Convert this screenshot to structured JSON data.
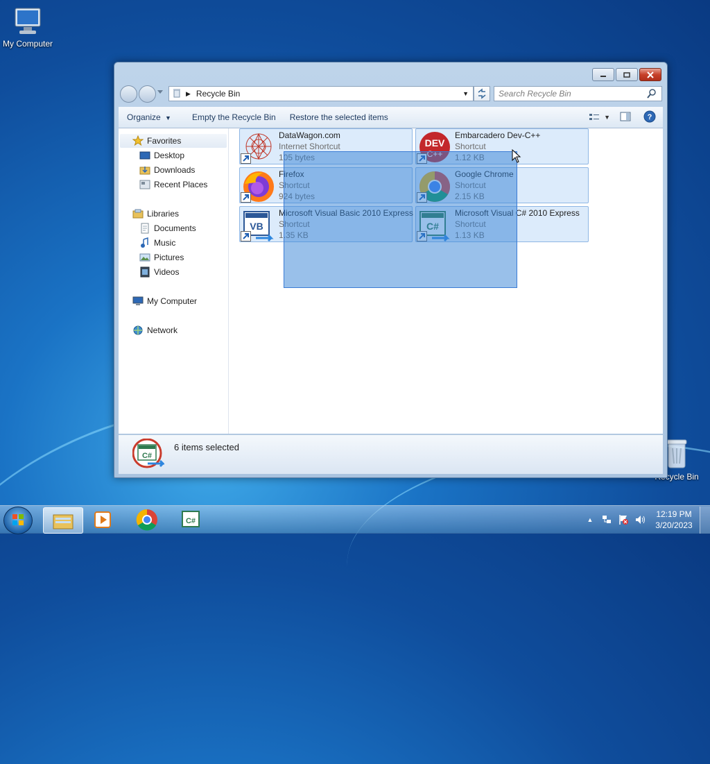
{
  "desktop": {
    "icons": [
      {
        "label": "My Computer",
        "icon": "computer-icon"
      },
      {
        "label": "Recycle Bin",
        "icon": "recycle-bin-icon"
      }
    ]
  },
  "window": {
    "address": {
      "location": "Recycle Bin"
    },
    "search": {
      "placeholder": "Search Recycle Bin"
    },
    "toolbar": {
      "organize": "Organize",
      "empty": "Empty the Recycle Bin",
      "restore": "Restore the selected items"
    },
    "nav": {
      "favorites": "Favorites",
      "desktop": "Desktop",
      "downloads": "Downloads",
      "recent_places": "Recent Places",
      "libraries": "Libraries",
      "documents": "Documents",
      "music": "Music",
      "pictures": "Pictures",
      "videos": "Videos",
      "my_computer": "My Computer",
      "network": "Network"
    },
    "items": [
      {
        "name": "DataWagon.com",
        "type": "Internet Shortcut",
        "size": "105 bytes",
        "icon": "datawagon-icon"
      },
      {
        "name": "Embarcadero Dev-C++",
        "type": "Shortcut",
        "size": "1.12 KB",
        "icon": "devcpp-icon"
      },
      {
        "name": "Firefox",
        "type": "Shortcut",
        "size": "924 bytes",
        "icon": "firefox-icon"
      },
      {
        "name": "Google Chrome",
        "type": "Shortcut",
        "size": "2.15 KB",
        "icon": "chrome-icon"
      },
      {
        "name": "Microsoft Visual Basic 2010 Express",
        "type": "Shortcut",
        "size": "1.35 KB",
        "icon": "visual-basic-icon"
      },
      {
        "name": "Microsoft Visual C# 2010 Express",
        "type": "Shortcut",
        "size": "1.13 KB",
        "icon": "visual-csharp-icon"
      }
    ],
    "details": {
      "status": "6 items selected"
    }
  },
  "taskbar": {
    "pinned": [
      "windows-explorer-icon",
      "media-player-icon",
      "chrome-icon",
      "visual-csharp-icon"
    ],
    "clock": {
      "time": "12:19 PM",
      "date": "3/20/2023"
    }
  }
}
